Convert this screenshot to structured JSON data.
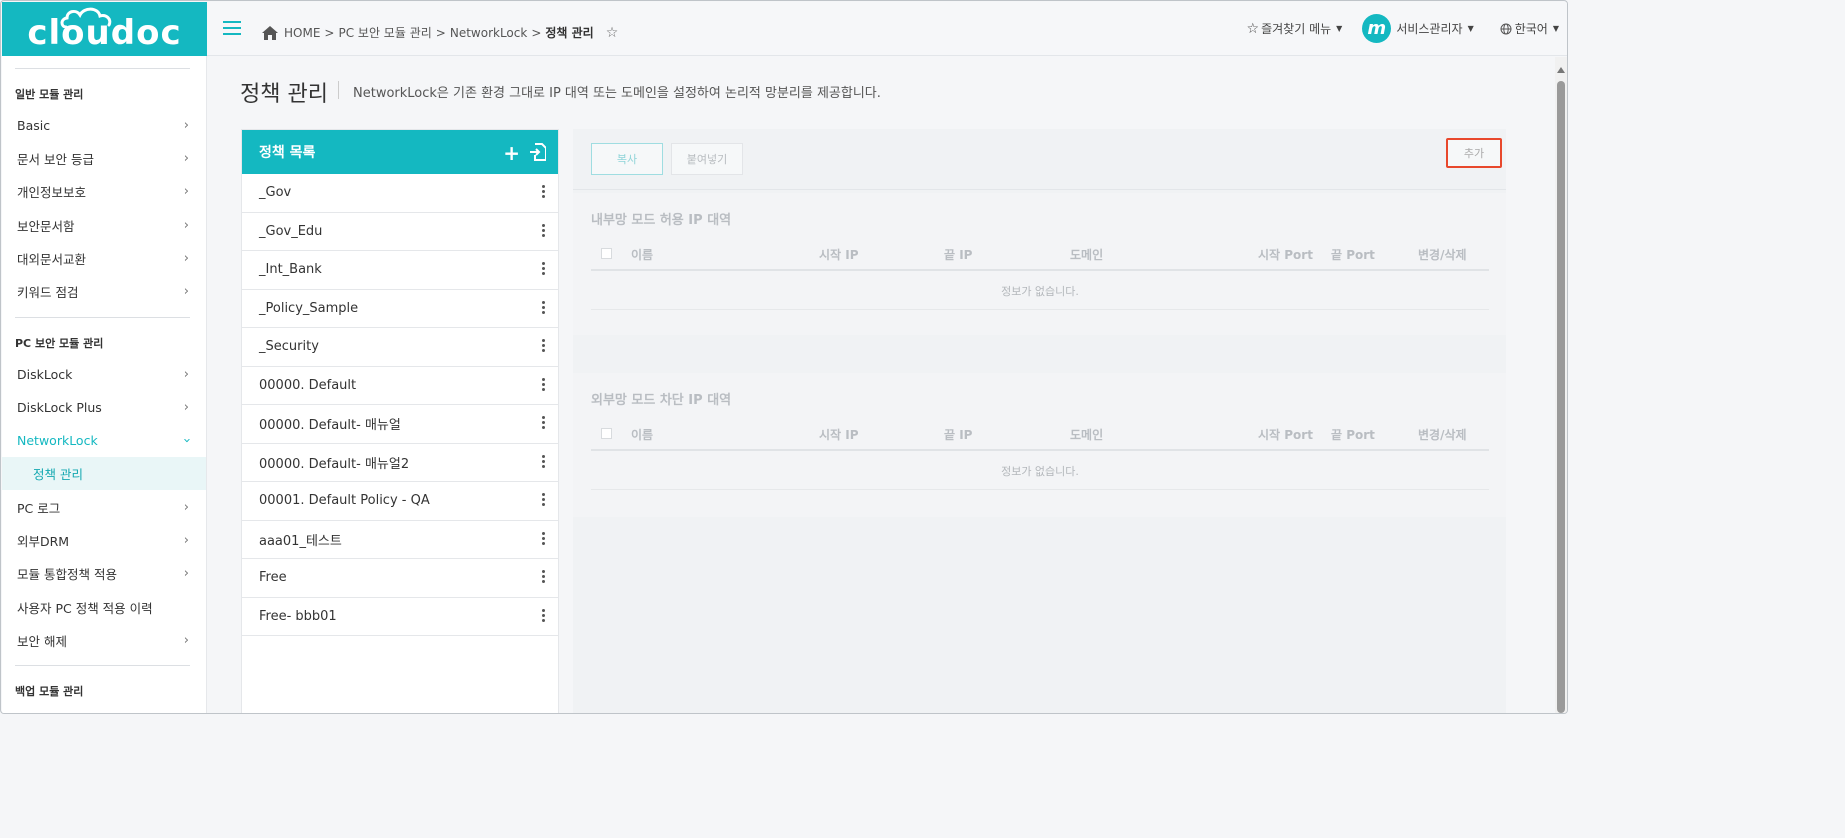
{
  "logo": {
    "text": "cloudoc"
  },
  "header": {
    "breadcrumb": {
      "home": "HOME",
      "items": [
        "PC 보안 모듈 관리",
        "NetworkLock",
        "정책 관리"
      ],
      "separator": ">"
    },
    "favorites_label": "즐겨찾기 메뉴",
    "user_avatar_letter": "m",
    "user_label": "서비스관리자",
    "language_label": "한국어"
  },
  "sidebar": {
    "section_general": "일반 모듈 관리",
    "general_items": [
      "Basic",
      "문서 보안 등급",
      "개인정보보호",
      "보안문서함",
      "대외문서교환",
      "키워드 점검"
    ],
    "section_pc": "PC 보안 모듈 관리",
    "pc_items": [
      "DiskLock",
      "DiskLock Plus",
      "NetworkLock"
    ],
    "pc_sub_item": "정책 관리",
    "pc_items_after": [
      "PC 로그",
      "외부DRM",
      "모듈 통합정책 적용",
      "사용자 PC 정책 적용 이력",
      "보안 해제"
    ],
    "section_backup": "백업 모듈 관리"
  },
  "page": {
    "title": "정책 관리",
    "description": "NetworkLock은 기존 환경 그대로 IP 대역 또는 도메인을 설정하여 논리적 망분리를 제공합니다."
  },
  "policy_list": {
    "header": "정책 목록",
    "items": [
      "_Gov",
      "_Gov_Edu",
      "_Int_Bank",
      "_Policy_Sample",
      "_Security",
      "00000. Default",
      "00000. Default- 매뉴얼",
      "00000. Default- 매뉴얼2",
      "00001. Default Policy - QA",
      "aaa01_테스트",
      "Free",
      "Free- bbb01"
    ]
  },
  "panel": {
    "copy_label": "복사",
    "paste_label": "붙여넣기",
    "add_label": "추가",
    "columns": [
      "이름",
      "시작 IP",
      "끝 IP",
      "도메인",
      "시작 Port",
      "끝 Port",
      "변경/삭제"
    ],
    "internal_title": "내부망 모드 허용 IP 대역",
    "external_title": "외부망 모드 차단 IP 대역",
    "no_data": "정보가 없습니다."
  },
  "colors": {
    "accent": "#14b8c1",
    "highlight_border": "#e8482c"
  }
}
